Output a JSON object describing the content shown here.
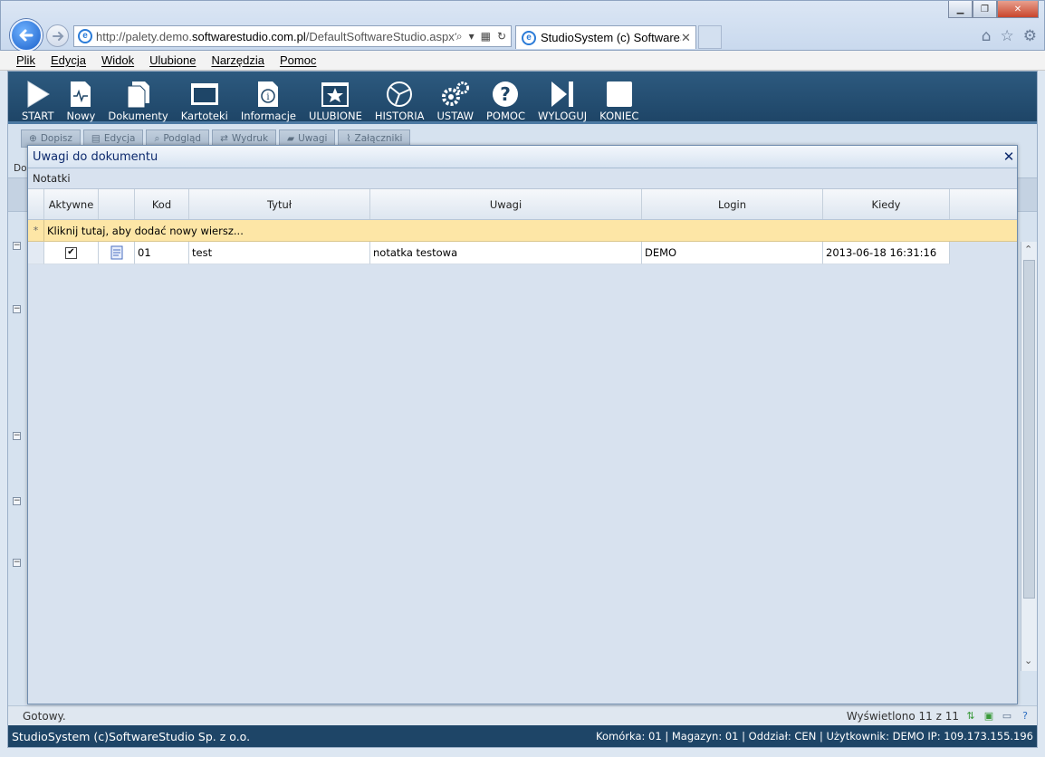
{
  "browser": {
    "url_prefix": "http://palety.demo.",
    "url_domain": "softwarestudio.com.pl",
    "url_suffix": "/DefaultSoftwareStudio.aspx?rol",
    "tab_title": "StudioSystem (c) SoftwareS...",
    "tab_close": "✕"
  },
  "menu": [
    "Plik",
    "Edycja",
    "Widok",
    "Ulubione",
    "Narzędzia",
    "Pomoc"
  ],
  "toolbar": [
    {
      "label": "START",
      "icon": "play-icon"
    },
    {
      "label": "Nowy",
      "icon": "new-document-icon"
    },
    {
      "label": "Dokumenty",
      "icon": "documents-icon"
    },
    {
      "label": "Kartoteki",
      "icon": "window-icon"
    },
    {
      "label": "Informacje",
      "icon": "info-icon"
    },
    {
      "label": "ULUBIONE",
      "icon": "star-icon"
    },
    {
      "label": "HISTORIA",
      "icon": "history-icon"
    },
    {
      "label": "USTAW",
      "icon": "gears-icon"
    },
    {
      "label": "POMOC",
      "icon": "help-icon"
    },
    {
      "label": "WYLOGUJ",
      "icon": "logout-icon"
    },
    {
      "label": "KONIEC",
      "icon": "stop-icon"
    }
  ],
  "subtoolbar": [
    "Dopisz",
    "Edycja",
    "Podgląd",
    "Wydruk",
    "Uwagi",
    "Załączniki"
  ],
  "background": {
    "label": "Do"
  },
  "modal": {
    "title": "Uwagi do dokumentu",
    "close": "✕",
    "tab": "Notatki",
    "columns": [
      "Aktywne",
      "",
      "Kod",
      "Tytuł",
      "Uwagi",
      "Login",
      "Kiedy"
    ],
    "new_row": "Kliknij tutaj, aby dodać nowy wiersz...",
    "rows": [
      {
        "active": true,
        "kod": "01",
        "tytul": "test",
        "uwagi": "notatka testowa",
        "login": "DEMO",
        "kiedy": "2013-06-18 16:31:16"
      }
    ]
  },
  "status": {
    "left": "Gotowy.",
    "right": "Wyświetlono 11 z 11"
  },
  "footer": {
    "left": "StudioSystem (c)SoftwareStudio Sp. z o.o.",
    "right": "Komórka: 01 | Magazyn: 01 | Oddział: CEN | Użytkownik: DEMO IP: 109.173.155.196"
  },
  "colors": {
    "toolbar": "#1e4567",
    "new_row": "#fde6a6",
    "title_text": "#0d2a6d"
  }
}
